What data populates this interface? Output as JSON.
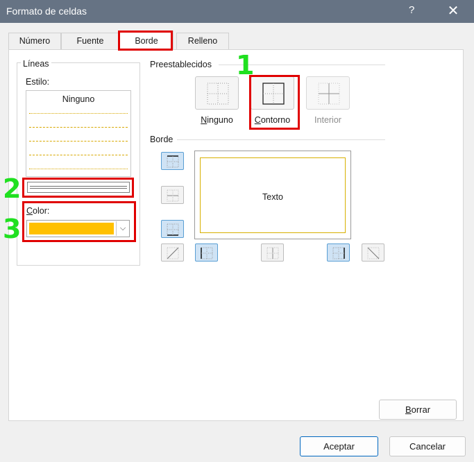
{
  "window": {
    "title": "Formato de celdas",
    "help": "?",
    "close": "✕"
  },
  "tabs": [
    {
      "label": "Número"
    },
    {
      "label": "Fuente"
    },
    {
      "label": "Borde"
    },
    {
      "label": "Relleno"
    }
  ],
  "lines": {
    "group_label": "Líneas",
    "style_label": "Estilo:",
    "none_option": "Ninguno",
    "color_label": "Color:",
    "color_value": "#ffc000"
  },
  "presets": {
    "label": "Preestablecidos",
    "items": [
      {
        "label": "Ninguno"
      },
      {
        "label": "Contorno"
      },
      {
        "label": "Interior"
      }
    ]
  },
  "border": {
    "label": "Borde",
    "preview_text": "Texto"
  },
  "buttons": {
    "clear": "Borrar",
    "accept": "Aceptar",
    "cancel": "Cancelar"
  },
  "annotations": {
    "one": "1",
    "two": "2",
    "three": "3"
  },
  "colors": {
    "titlebar": "#667384",
    "highlight": "#e00000",
    "annotation": "#20e020",
    "border_accent": "#ffc000"
  }
}
